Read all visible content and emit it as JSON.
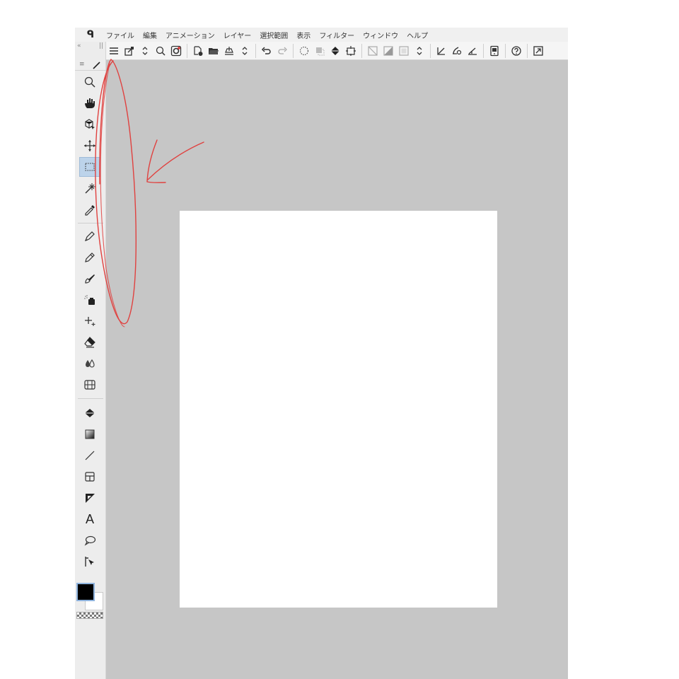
{
  "menubar": {
    "logo_glyph": "ᑫ",
    "items": [
      "ファイル",
      "編集",
      "アニメーション",
      "レイヤー",
      "選択範囲",
      "表示",
      "フィルター",
      "ウィンドウ",
      "ヘルプ"
    ]
  },
  "toolbar": {
    "collapse_glyph": "«",
    "grip_glyph": "||",
    "buttons": [
      "menu-icon",
      "transform-icon",
      "chevron-updown-icon",
      "zoom-icon",
      "clip-studio-icon",
      "sep",
      "new-file-icon",
      "open-folder-icon",
      "save-icon",
      "chevron-updown-icon",
      "sep",
      "undo-icon",
      "redo-icon",
      "sep",
      "deselect-icon",
      "invert-selection-icon",
      "fill-icon",
      "crop-icon",
      "sep",
      "ruler-off-icon",
      "ruler-gray-icon",
      "frame-icon",
      "chevron-updown-icon",
      "sep",
      "correction-icon",
      "stabilizer-icon",
      "vector-icon",
      "sep",
      "companion-icon",
      "sep",
      "help-icon",
      "sep",
      "fullscreen-icon"
    ]
  },
  "sidepanel": {
    "tab_glyph": "≡",
    "tools": [
      "zoom-tool-icon",
      "hand-tool-icon",
      "operation-tool-icon",
      "move-layer-icon",
      "selection-area-icon",
      "auto-select-icon",
      "eyedropper-icon",
      "sep",
      "pen-icon",
      "pencil-icon",
      "brush-icon",
      "airbrush-icon",
      "decoration-icon",
      "eraser-icon",
      "blend-icon",
      "perspective-ruler-icon",
      "sep",
      "fill-tool-icon",
      "gradient-icon",
      "figure-line-icon",
      "frame-border-icon",
      "ruler-tool-icon",
      "text-tool-icon",
      "balloon-icon",
      "correct-line-icon"
    ],
    "active_tool": "selection-area-icon",
    "text_tool_glyph": "A"
  },
  "colors": {
    "main_color": "#000000",
    "sub_color": "#ffffff",
    "annotation": "#e0413f",
    "canvas_bg": "#c6c6c6"
  }
}
